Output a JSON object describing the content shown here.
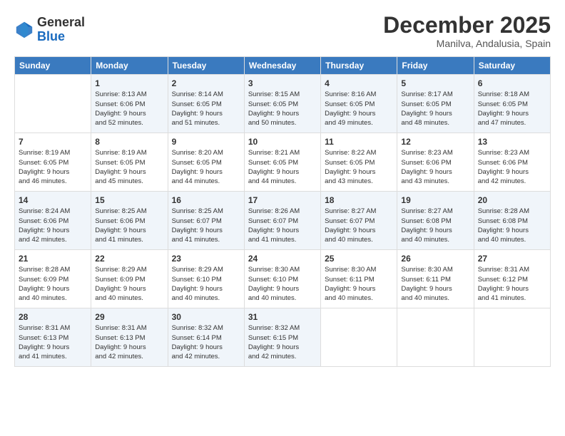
{
  "header": {
    "logo": {
      "general": "General",
      "blue": "Blue"
    },
    "title": "December 2025",
    "location": "Manilva, Andalusia, Spain"
  },
  "calendar": {
    "days": [
      "Sunday",
      "Monday",
      "Tuesday",
      "Wednesday",
      "Thursday",
      "Friday",
      "Saturday"
    ],
    "weeks": [
      [
        {
          "day": "",
          "info": ""
        },
        {
          "day": "1",
          "info": "Sunrise: 8:13 AM\nSunset: 6:06 PM\nDaylight: 9 hours\nand 52 minutes."
        },
        {
          "day": "2",
          "info": "Sunrise: 8:14 AM\nSunset: 6:05 PM\nDaylight: 9 hours\nand 51 minutes."
        },
        {
          "day": "3",
          "info": "Sunrise: 8:15 AM\nSunset: 6:05 PM\nDaylight: 9 hours\nand 50 minutes."
        },
        {
          "day": "4",
          "info": "Sunrise: 8:16 AM\nSunset: 6:05 PM\nDaylight: 9 hours\nand 49 minutes."
        },
        {
          "day": "5",
          "info": "Sunrise: 8:17 AM\nSunset: 6:05 PM\nDaylight: 9 hours\nand 48 minutes."
        },
        {
          "day": "6",
          "info": "Sunrise: 8:18 AM\nSunset: 6:05 PM\nDaylight: 9 hours\nand 47 minutes."
        }
      ],
      [
        {
          "day": "7",
          "info": "Sunrise: 8:19 AM\nSunset: 6:05 PM\nDaylight: 9 hours\nand 46 minutes."
        },
        {
          "day": "8",
          "info": "Sunrise: 8:19 AM\nSunset: 6:05 PM\nDaylight: 9 hours\nand 45 minutes."
        },
        {
          "day": "9",
          "info": "Sunrise: 8:20 AM\nSunset: 6:05 PM\nDaylight: 9 hours\nand 44 minutes."
        },
        {
          "day": "10",
          "info": "Sunrise: 8:21 AM\nSunset: 6:05 PM\nDaylight: 9 hours\nand 44 minutes."
        },
        {
          "day": "11",
          "info": "Sunrise: 8:22 AM\nSunset: 6:05 PM\nDaylight: 9 hours\nand 43 minutes."
        },
        {
          "day": "12",
          "info": "Sunrise: 8:23 AM\nSunset: 6:06 PM\nDaylight: 9 hours\nand 43 minutes."
        },
        {
          "day": "13",
          "info": "Sunrise: 8:23 AM\nSunset: 6:06 PM\nDaylight: 9 hours\nand 42 minutes."
        }
      ],
      [
        {
          "day": "14",
          "info": "Sunrise: 8:24 AM\nSunset: 6:06 PM\nDaylight: 9 hours\nand 42 minutes."
        },
        {
          "day": "15",
          "info": "Sunrise: 8:25 AM\nSunset: 6:06 PM\nDaylight: 9 hours\nand 41 minutes."
        },
        {
          "day": "16",
          "info": "Sunrise: 8:25 AM\nSunset: 6:07 PM\nDaylight: 9 hours\nand 41 minutes."
        },
        {
          "day": "17",
          "info": "Sunrise: 8:26 AM\nSunset: 6:07 PM\nDaylight: 9 hours\nand 41 minutes."
        },
        {
          "day": "18",
          "info": "Sunrise: 8:27 AM\nSunset: 6:07 PM\nDaylight: 9 hours\nand 40 minutes."
        },
        {
          "day": "19",
          "info": "Sunrise: 8:27 AM\nSunset: 6:08 PM\nDaylight: 9 hours\nand 40 minutes."
        },
        {
          "day": "20",
          "info": "Sunrise: 8:28 AM\nSunset: 6:08 PM\nDaylight: 9 hours\nand 40 minutes."
        }
      ],
      [
        {
          "day": "21",
          "info": "Sunrise: 8:28 AM\nSunset: 6:09 PM\nDaylight: 9 hours\nand 40 minutes."
        },
        {
          "day": "22",
          "info": "Sunrise: 8:29 AM\nSunset: 6:09 PM\nDaylight: 9 hours\nand 40 minutes."
        },
        {
          "day": "23",
          "info": "Sunrise: 8:29 AM\nSunset: 6:10 PM\nDaylight: 9 hours\nand 40 minutes."
        },
        {
          "day": "24",
          "info": "Sunrise: 8:30 AM\nSunset: 6:10 PM\nDaylight: 9 hours\nand 40 minutes."
        },
        {
          "day": "25",
          "info": "Sunrise: 8:30 AM\nSunset: 6:11 PM\nDaylight: 9 hours\nand 40 minutes."
        },
        {
          "day": "26",
          "info": "Sunrise: 8:30 AM\nSunset: 6:11 PM\nDaylight: 9 hours\nand 40 minutes."
        },
        {
          "day": "27",
          "info": "Sunrise: 8:31 AM\nSunset: 6:12 PM\nDaylight: 9 hours\nand 41 minutes."
        }
      ],
      [
        {
          "day": "28",
          "info": "Sunrise: 8:31 AM\nSunset: 6:13 PM\nDaylight: 9 hours\nand 41 minutes."
        },
        {
          "day": "29",
          "info": "Sunrise: 8:31 AM\nSunset: 6:13 PM\nDaylight: 9 hours\nand 42 minutes."
        },
        {
          "day": "30",
          "info": "Sunrise: 8:32 AM\nSunset: 6:14 PM\nDaylight: 9 hours\nand 42 minutes."
        },
        {
          "day": "31",
          "info": "Sunrise: 8:32 AM\nSunset: 6:15 PM\nDaylight: 9 hours\nand 42 minutes."
        },
        {
          "day": "",
          "info": ""
        },
        {
          "day": "",
          "info": ""
        },
        {
          "day": "",
          "info": ""
        }
      ]
    ]
  }
}
